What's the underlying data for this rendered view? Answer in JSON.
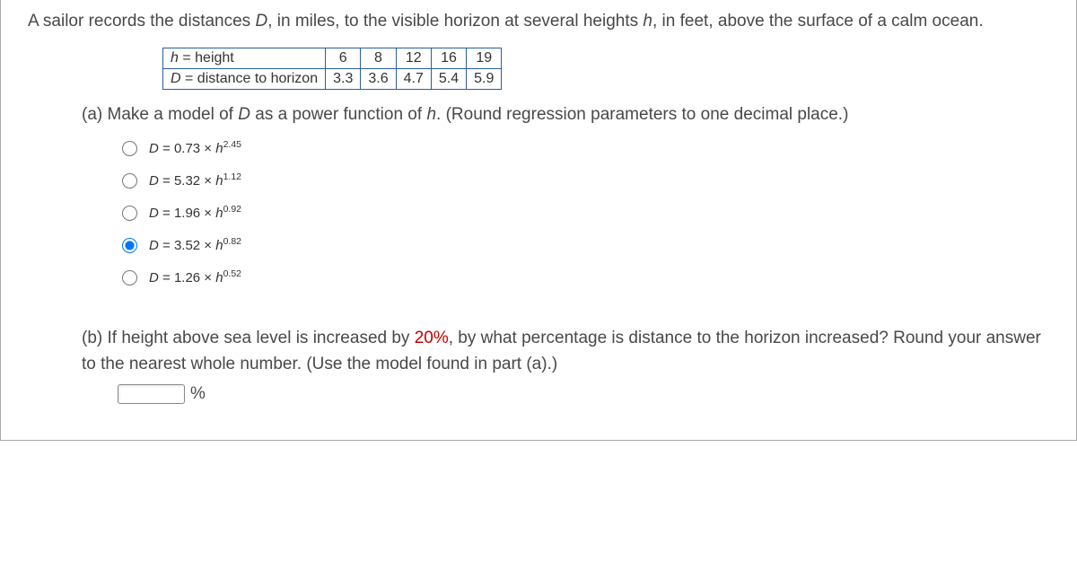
{
  "intro_1": "A sailor records the distances ",
  "intro_D": "D",
  "intro_2": ", in miles, to the visible horizon at several heights ",
  "intro_h": "h",
  "intro_3": ", in feet, above the surface of a calm ocean.",
  "table": {
    "row1_label_var": "h",
    "row1_label_eq": " = height",
    "row2_label_var": "D",
    "row2_label_eq": " = distance to horizon",
    "h_vals": [
      "6",
      "8",
      "12",
      "16",
      "19"
    ],
    "d_vals": [
      "3.3",
      "3.6",
      "4.7",
      "5.4",
      "5.9"
    ]
  },
  "partA": {
    "prefix": "(a) Make a model of ",
    "var1": "D",
    "mid1": " as a power function of ",
    "var2": "h",
    "suffix": ". (Round regression parameters to one decimal place.)",
    "options": [
      {
        "coef": "0.73",
        "exp": "2.45",
        "selected": false
      },
      {
        "coef": "5.32",
        "exp": "1.12",
        "selected": false
      },
      {
        "coef": "1.96",
        "exp": "0.92",
        "selected": false
      },
      {
        "coef": "3.52",
        "exp": "0.82",
        "selected": true
      },
      {
        "coef": "1.26",
        "exp": "0.52",
        "selected": false
      }
    ]
  },
  "partB": {
    "prefix": "(b) If height above sea level is increased by ",
    "pct": "20%",
    "suffix": ", by what percentage is distance to the horizon increased? Round your answer to the nearest whole number. (Use the model found in part (a).)",
    "unit": "%",
    "value": ""
  }
}
